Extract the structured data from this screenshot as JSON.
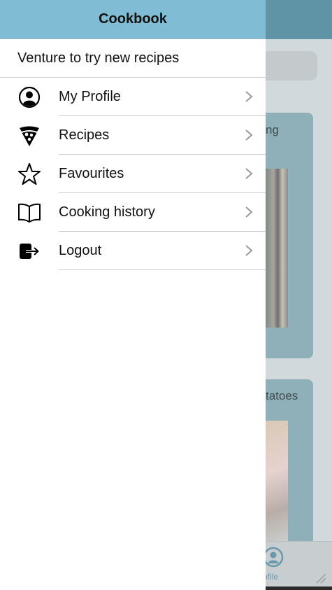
{
  "background": {
    "card1_title": "ng",
    "card2_title": "tatoes",
    "tabbar_label": "rofile"
  },
  "drawer": {
    "title": "Cookbook",
    "subtitle": "Venture to try new recipes",
    "items": [
      {
        "label": "My Profile",
        "icon": "user-circle-icon"
      },
      {
        "label": "Recipes",
        "icon": "pizza-slice-icon"
      },
      {
        "label": "Favourites",
        "icon": "star-icon"
      },
      {
        "label": "Cooking history",
        "icon": "open-book-icon"
      },
      {
        "label": "Logout",
        "icon": "logout-icon"
      }
    ]
  },
  "colors": {
    "header": "#80bdd4",
    "overlay_header": "#5f93a6",
    "tab_active": "#6a98ad"
  }
}
